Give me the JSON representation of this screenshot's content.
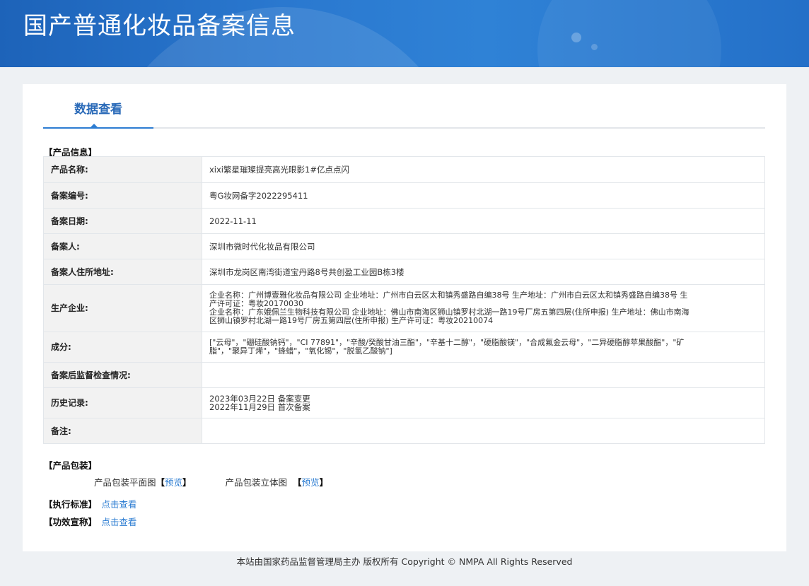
{
  "header": {
    "title": "国产普通化妆品备案信息"
  },
  "tabs": [
    {
      "label": "数据查看"
    }
  ],
  "product_info": {
    "section_title": "【产品信息】",
    "rows": [
      {
        "label": "产品名称:",
        "value": "xixi繁星璀璨提亮高光眼影1#亿点点闪"
      },
      {
        "label": "备案编号:",
        "value": "粤G妆网备字2022295411"
      },
      {
        "label": "备案日期:",
        "value": "2022-11-11"
      },
      {
        "label": "备案人:",
        "value": "深圳市微时代化妆品有限公司"
      },
      {
        "label": "备案人住所地址:",
        "value": "深圳市龙岗区南湾街道宝丹路8号共创盈工业园B栋3楼"
      },
      {
        "label": "生产企业:",
        "lines": [
          "企业名称：广州博壹雅化妆品有限公司 企业地址：广州市白云区太和镇秀盛路自编38号 生产地址：广州市白云区太和镇秀盛路自编38号 生",
          "产许可证：粤妆20170030",
          "企业名称：广东娥佩兰生物科技有限公司 企业地址：佛山市南海区狮山镇罗村北湖一路19号厂房五第四层(住所申报) 生产地址：佛山市南海",
          "区狮山镇罗村北湖一路19号厂房五第四层(住所申报) 生产许可证：粤妆20210074"
        ]
      },
      {
        "label": "成分:",
        "lines": [
          "[\"云母\"，\"硼硅酸钠钙\"，\"CI 77891\"，\"辛酸/癸酸甘油三酯\"，\"辛基十二醇\"，\"硬脂酸镁\"，\"合成氟金云母\"，\"二异硬脂醇苹果酸酯\"，\"矿",
          "脂\"，\"聚异丁烯\"，\"蜂蜡\"，\"氧化锡\"，\"脱氢乙酸钠\"]"
        ]
      },
      {
        "label": "备案后监督检查情况:",
        "value": ""
      },
      {
        "label": "历史记录:",
        "lines": [
          "2023年03月22日 备案变更",
          "2022年11月29日 首次备案"
        ]
      },
      {
        "label": "备注:",
        "value": ""
      }
    ]
  },
  "packaging": {
    "section_title": "【产品包装】",
    "flat_label": "产品包装平面图",
    "solid_label": "产品包装立体图",
    "bracket_open": "【",
    "bracket_close": "】",
    "preview_label": "预览"
  },
  "standard": {
    "label": "【执行标准】",
    "link": "点击查看"
  },
  "efficacy": {
    "label": "【功效宣称】",
    "link": "点击查看"
  },
  "footer": {
    "text": "本站由国家药品监督管理局主办 版权所有 Copyright © NMPA All Rights Reserved"
  }
}
